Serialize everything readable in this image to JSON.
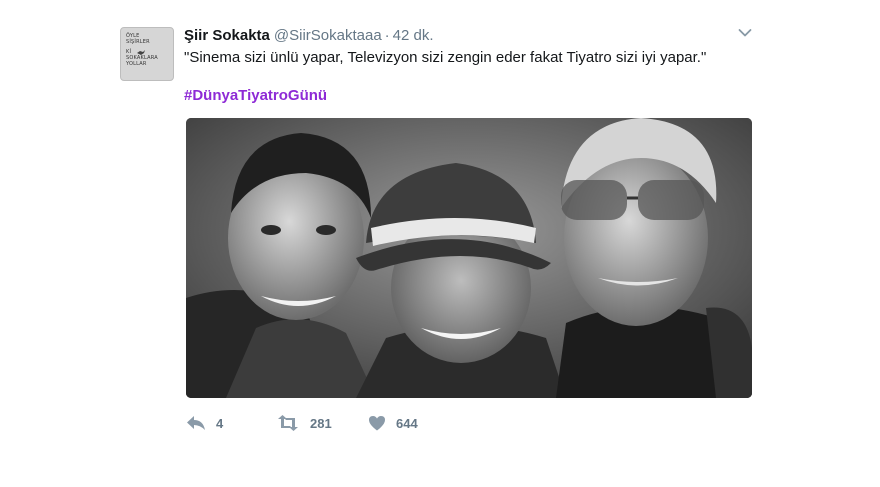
{
  "author": {
    "fullname": "Şiir Sokakta",
    "username": "@SiirSokaktaaa",
    "separator": "·",
    "time": "42 dk.",
    "avatar_lines": [
      "ÖYLE",
      "SİŞİRLER",
      "Kİ",
      "SOKAKLARA",
      "YOLLAR"
    ]
  },
  "tweet": {
    "text": "\"Sinema sizi ünlü yapar, Televizyon sizi zengin eder fakat Tiyatro sizi iyi yapar.\"",
    "hashtag": "#DünyaTiyatroGünü"
  },
  "media": {
    "alt": "",
    "style": "black-and-white photo of three smiling older men"
  },
  "actions": {
    "reply_count": "4",
    "retweet_count": "281",
    "like_count": "644"
  },
  "colors": {
    "text": "#14171a",
    "secondary": "#657786",
    "hashtag": "#8e2ad6",
    "action_icon": "#8a9aa8"
  },
  "icons": {
    "caret": "chevron-down-icon",
    "reply": "reply-icon",
    "retweet": "retweet-icon",
    "like": "heart-icon"
  }
}
